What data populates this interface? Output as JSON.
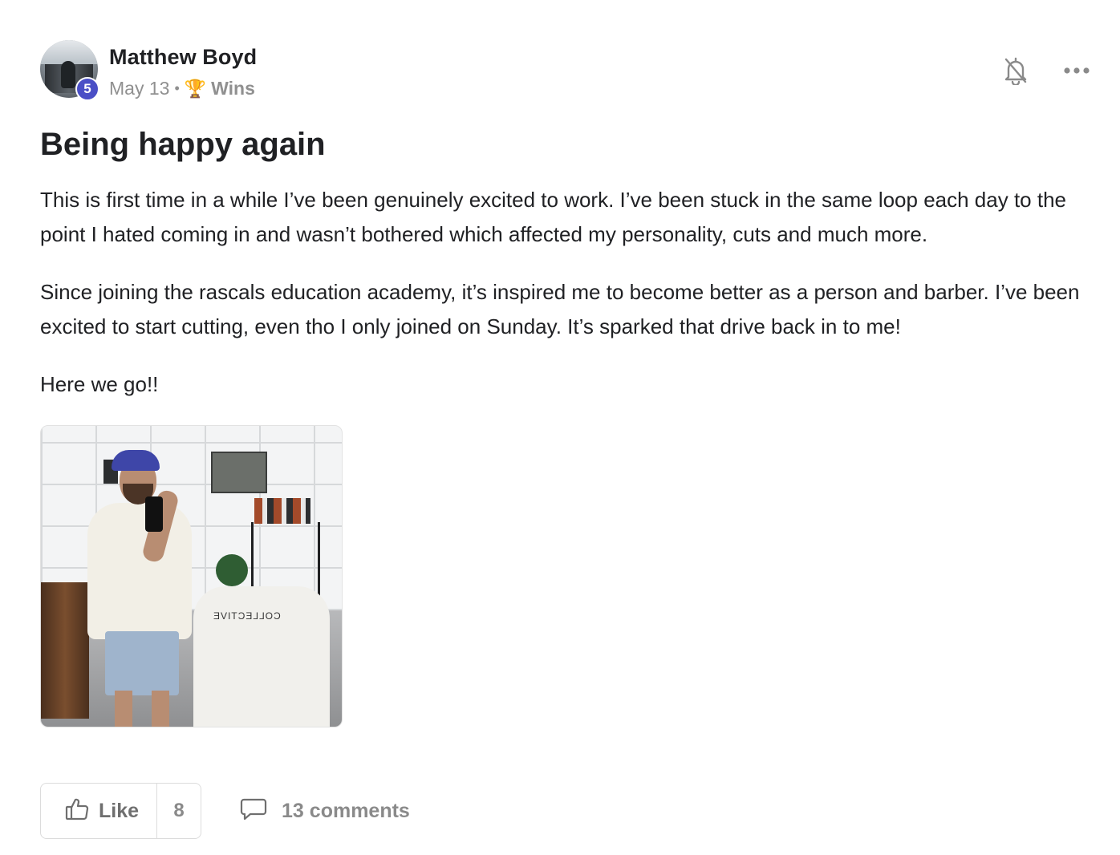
{
  "post": {
    "author": "Matthew Boyd",
    "level": "5",
    "date": "May 13",
    "separator": "•",
    "category": "Wins",
    "title": "Being happy again",
    "paragraphs": [
      "This is first time in a while I’ve been genuinely excited to work. I’ve been stuck in the same loop each day to the point I hated coming in and wasn’t bothered which affected my personality, cuts and much more.",
      "Since joining the rascals education academy, it’s inspired me to become better as a person and barber. I’ve been excited to start cutting, even tho I only joined on Sunday. It’s sparked that drive back in to me!",
      "Here we go!!"
    ],
    "image_cape_text": "COLLECTIVE"
  },
  "icons": {
    "notification": "bell-off-icon",
    "more": "more-horizontal-icon",
    "like": "thumbs-up-icon",
    "comments": "comment-bubble-icon",
    "category": "trophy-icon"
  },
  "actions": {
    "like_label": "Like",
    "like_count": "8",
    "comments_label": "13 comments"
  },
  "colors": {
    "level_badge": "#4a4fc6",
    "muted_text": "#909090",
    "text": "#202124"
  }
}
